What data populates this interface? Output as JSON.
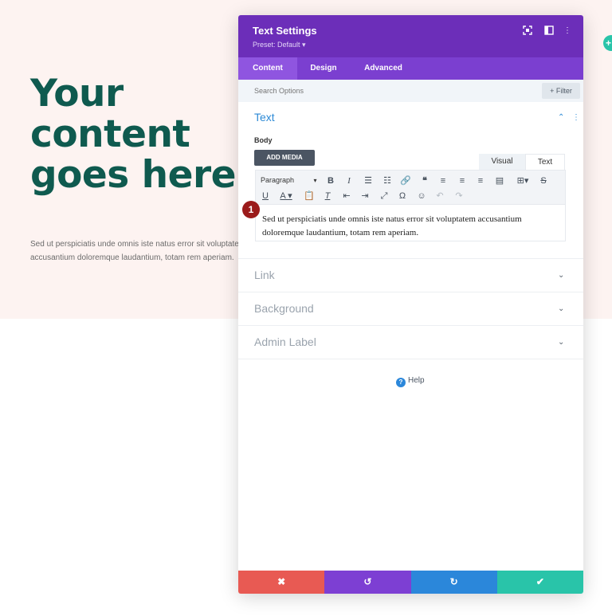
{
  "page": {
    "title_lines": [
      "Your",
      "content",
      "goes here."
    ],
    "body_lines": [
      "Sed ut perspiciatis unde omnis iste natus error sit voluptatem",
      "accusantium doloremque laudantium, totam rem aperiam."
    ],
    "edge_icon": "plus-icon"
  },
  "modal": {
    "title": "Text Settings",
    "preset": "Preset: Default ▾",
    "tabs": [
      {
        "label": "Content",
        "active": true
      },
      {
        "label": "Design",
        "active": false
      },
      {
        "label": "Advanced",
        "active": false
      }
    ],
    "search_placeholder": "Search Options",
    "filter_label": "+ Filter",
    "text_section": {
      "heading": "Text",
      "body_label": "Body",
      "add_media_label": "ADD MEDIA",
      "mode_tabs": [
        "Visual",
        "Text"
      ],
      "paragraph_select": "Paragraph",
      "content": "Sed ut perspiciatis unde omnis iste natus error sit voluptatem accusantium doloremque laudantium, totam rem aperiam."
    },
    "badge": "1",
    "collapsed_sections": [
      "Link",
      "Background",
      "Admin Label"
    ],
    "help_label": "Help",
    "colors": {
      "header": "#6c2eb9",
      "cancel": "#e85a53",
      "undo": "#7d3fd3",
      "redo": "#2b87da",
      "save": "#29c4a9"
    }
  }
}
